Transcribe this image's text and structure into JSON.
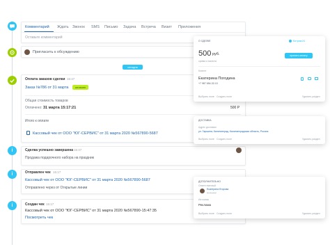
{
  "tabs": [
    "Комментарий",
    "Ждать",
    "Звонок",
    "SMS",
    "Письмо",
    "Задача",
    "Встреча",
    "Визит",
    "Приложения"
  ],
  "comment_placeholder": "Оставьте комментарий",
  "invite": "Пригласить к обсуждению",
  "today_badge": "сегодня",
  "payment": {
    "title": "Оплата заказов сделки",
    "time": "15:47",
    "order_link": "Заказ №786 от 31 марта",
    "paid_badge": "оплачен",
    "total_label": "Общая стоимость товаров",
    "total_value": "500 Р",
    "paid_label": "Оплачено:",
    "paid_date": "31 марта 15:17:21",
    "paid_value": "500 Р",
    "summary": "Итого к оплате",
    "receipt": "Кассовый чек от ООО \"ЮГ-СЕРВИС\" от 31 марта 2020 №567890-5687"
  },
  "deal_done": {
    "title": "Сделка успешно завершена",
    "time": "15:47",
    "text": "Продажа подарочного набора на праздник"
  },
  "check_sent": {
    "title": "Отправлен чек",
    "time": "15:17",
    "link": "Кассовый чек от ООО \"ЮГ-СЕРВИС\" от 31 марта 2020 №567890-5687",
    "text": "Отправлено через от Открытые линии"
  },
  "check_created": {
    "title": "Создан чек",
    "time": "15:17",
    "text": "Кассовый чек от ООО \"ЮГ-СЕРВИС\" от 31 марта 2020 №567890-15:47:35",
    "link": "Посмотреть чек"
  },
  "right_deal": {
    "header": "О СДЕЛКЕ",
    "partner": "Битрикс24",
    "amount": "500",
    "currency": "руб.",
    "amount_note": "сумма и валюта",
    "pay_button": "принять оплату",
    "client_label": "Клиент",
    "client_name": "Екатерина Погодина",
    "client_phone": "+7 987 654-32-10",
    "select_field": "Выбрать поле",
    "create_field": "Создать поле",
    "delete_section": "Удалить раздел"
  },
  "right_delivery": {
    "header": "ДОСТАВКА",
    "address_label": "Адрес доставки",
    "address": "ул. Гаршина, Калининград, Калининградская область, Россия",
    "select_field": "Выбрать поле",
    "create_field": "Создать поле",
    "delete_section": "Удалить раздел"
  },
  "right_extra": {
    "header": "ДОПОЛНИТЕЛЬНО",
    "responsible_label": "Ответственный",
    "responsible_name": "Екатерина Егорова",
    "responsible_role": "менеджер",
    "source_label": "Источник",
    "source": "Реклама",
    "select_field": "Выбрать поле",
    "create_field": "Создать поле",
    "delete_section": "Удалить раздел"
  },
  "colors": {
    "blue": "#2fc6f6",
    "green": "#9dcf00",
    "link": "#2067b0",
    "pill_green": "#bbed21"
  }
}
